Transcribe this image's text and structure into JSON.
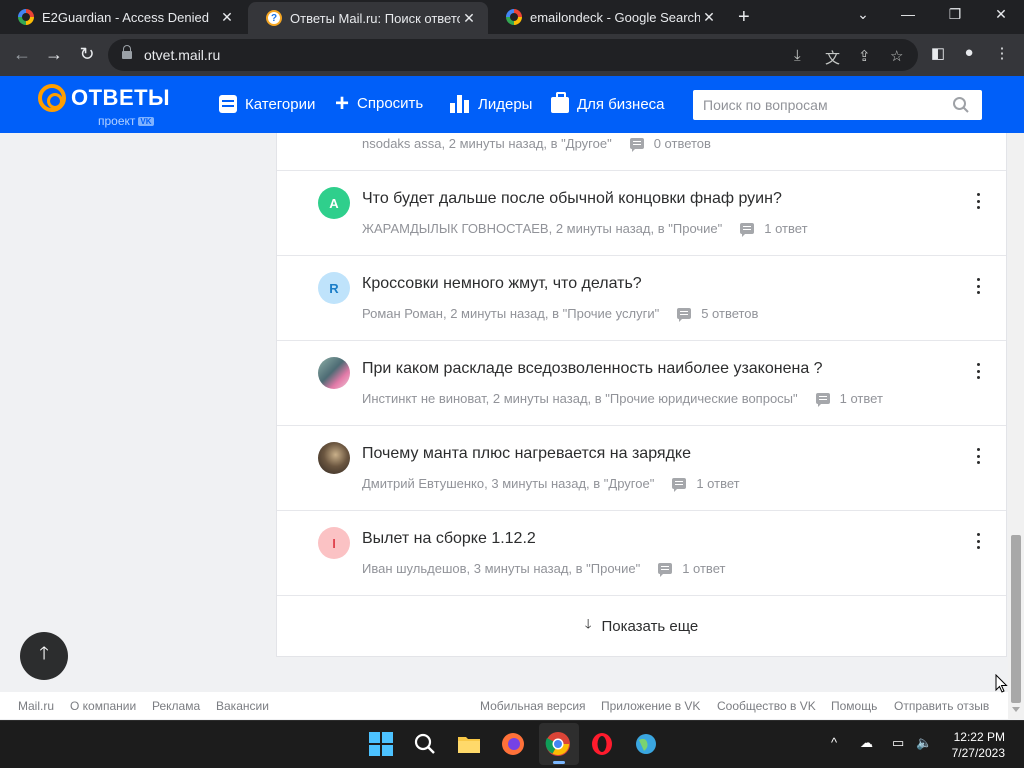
{
  "browser": {
    "tabs": [
      {
        "title": "E2Guardian - Access Denied",
        "favicon": "google-icon",
        "active": false
      },
      {
        "title": "Ответы Mail.ru: Поиск ответов н",
        "favicon": "otvety-icon",
        "active": true
      },
      {
        "title": "emailondeck - Google Search",
        "favicon": "google-icon",
        "active": false
      }
    ],
    "url": "otvet.mail.ru"
  },
  "site": {
    "logo_text": "ОТВЕТЫ",
    "logo_sub": "проект",
    "logo_badge": "VK",
    "nav": {
      "categories": "Категории",
      "ask": "Спросить",
      "leaders": "Лидеры",
      "business": "Для бизнеса"
    },
    "search_placeholder": "Поиск по вопросам",
    "brand_color": "#005ff9",
    "accent_color": "#ff9e00"
  },
  "questions": [
    {
      "title": "",
      "author": "nsodaks assa",
      "time": "2 минуты назад",
      "category": "в \"Другое\"",
      "answers": "0 ответов"
    },
    {
      "title": "Что будет дальше после обычной концовки фнаф руин?",
      "author": "ЖАРАМДЫЛЫК ГОВНОСТАЕВ",
      "time": "2 минуты назад",
      "category": "в \"Прочие\"",
      "answers": "1 ответ",
      "avatar_letter": "А",
      "avatar_color": "#2fcf8c"
    },
    {
      "title": "Кроссовки немного жмут, что делать?",
      "author": "Роман Роман",
      "time": "2 минуты назад",
      "category": "в \"Прочие услуги\"",
      "answers": "5 ответов",
      "avatar_letter": "R",
      "avatar_color": "#bfe3fb"
    },
    {
      "title": "При каком раскладе вседозволенность наиболее узаконена ?",
      "author": "Инстинкт не виноват",
      "time": "2 минуты назад",
      "category": "в \"Прочие юридические вопросы\"",
      "answers": "1 ответ"
    },
    {
      "title": "Почему манта плюс нагревается на зарядке",
      "author": "Дмитрий Евтушенко",
      "time": "3 минуты назад",
      "category": "в \"Другое\"",
      "answers": "1 ответ"
    },
    {
      "title": "Вылет на сборке 1.12.2",
      "author": "Иван шульдешов",
      "time": "3 минуты назад",
      "category": "в \"Прочие\"",
      "answers": "1 ответ",
      "avatar_letter": "I",
      "avatar_color": "#fbc2c4"
    }
  ],
  "show_more": "Показать еще",
  "footer": {
    "left": [
      "Mail.ru",
      "О компании",
      "Реклама",
      "Вакансии"
    ],
    "right": [
      "Мобильная версия",
      "Приложение в VK",
      "Сообщество в VK",
      "Помощь",
      "Отправить отзыв"
    ]
  },
  "taskbar": {
    "time": "12:22 PM",
    "date": "7/27/2023"
  }
}
